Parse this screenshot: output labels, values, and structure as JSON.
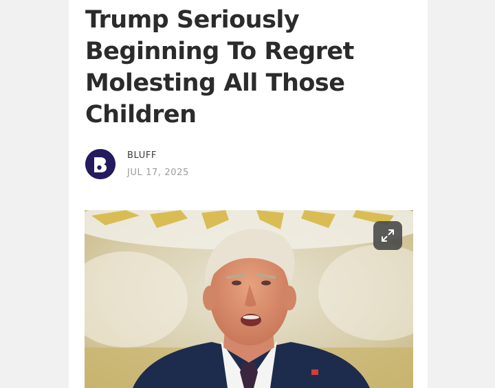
{
  "article": {
    "headline": "Trump Seriously Beginning To Regret Molesting All Those Children",
    "author": "BLUFF",
    "date": "JUL 17, 2025"
  },
  "icons": {
    "publisher_logo": "publisher-b-logo-icon",
    "expand": "expand-arrows-icon"
  },
  "colors": {
    "logo_background": "#241a5e",
    "headline_text": "#2b2b2b",
    "date_text": "#9b9b9b"
  }
}
